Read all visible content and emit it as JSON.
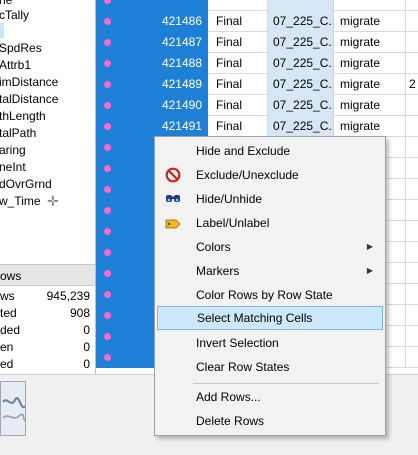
{
  "columns_panel": {
    "items": [
      {
        "label": "ne",
        "selected": false
      },
      {
        "label": "cTally",
        "selected": false
      },
      {
        "label": "",
        "selected": true
      },
      {
        "label": "SpdRes",
        "selected": false
      },
      {
        "label": "Attrb1",
        "selected": false
      },
      {
        "label": "imDistance",
        "selected": false
      },
      {
        "label": "talDistance",
        "selected": false
      },
      {
        "label": "thLength",
        "selected": false
      },
      {
        "label": "talPath",
        "selected": false
      },
      {
        "label": "aring",
        "selected": false
      },
      {
        "label": "neInt",
        "selected": false
      },
      {
        "label": "dOvrGrnd",
        "selected": false
      },
      {
        "label": "w_Time",
        "selected": false
      }
    ]
  },
  "rows_panel": {
    "header": "ows",
    "stats": [
      {
        "label": "ws",
        "value": "945,239"
      },
      {
        "label": "ted",
        "value": "908"
      },
      {
        "label": "ded",
        "value": "0"
      },
      {
        "label": "en",
        "value": "0"
      },
      {
        "label": "ed",
        "value": "0"
      }
    ]
  },
  "grid": {
    "rows": [
      {
        "id": "",
        "status": "",
        "code": "",
        "type": "",
        "last": ""
      },
      {
        "id": "421486",
        "status": "Final",
        "code": "07_225_C...",
        "type": "migrate",
        "last": ""
      },
      {
        "id": "421487",
        "status": "Final",
        "code": "07_225_C...",
        "type": "migrate",
        "last": ""
      },
      {
        "id": "421488",
        "status": "Final",
        "code": "07_225_C...",
        "type": "migrate",
        "last": ""
      },
      {
        "id": "421489",
        "status": "Final",
        "code": "07_225_C...",
        "type": "migrate",
        "last": "2"
      },
      {
        "id": "421490",
        "status": "Final",
        "code": "07_225_C...",
        "type": "migrate",
        "last": ""
      },
      {
        "id": "421491",
        "status": "Final",
        "code": "07_225_C...",
        "type": "migrate",
        "last": ""
      },
      {
        "id": "",
        "status": "",
        "code": "",
        "type": "",
        "last": ""
      },
      {
        "id": "",
        "status": "",
        "code": "",
        "type": "",
        "last": ""
      },
      {
        "id": "",
        "status": "",
        "code": "",
        "type": "",
        "last": ""
      },
      {
        "id": "",
        "status": "",
        "code": "",
        "type": "",
        "last": ""
      },
      {
        "id": "",
        "status": "",
        "code": "",
        "type": "",
        "last": ""
      },
      {
        "id": "",
        "status": "",
        "code": "",
        "type": "",
        "last": ""
      },
      {
        "id": "",
        "status": "",
        "code": "",
        "type": "",
        "last": ""
      },
      {
        "id": "",
        "status": "",
        "code": "",
        "type": "",
        "last": ""
      },
      {
        "id": "",
        "status": "",
        "code": "",
        "type": "",
        "last": ""
      },
      {
        "id": "",
        "status": "",
        "code": "",
        "type": "",
        "last": ""
      },
      {
        "id": "",
        "status": "",
        "code": "",
        "type": "",
        "last": ""
      }
    ]
  },
  "context_menu": {
    "items": [
      {
        "label": "Hide and Exclude",
        "icon": "",
        "submenu": false,
        "highlighted": false
      },
      {
        "label": "Exclude/Unexclude",
        "icon": "exclude-icon",
        "submenu": false,
        "highlighted": false
      },
      {
        "label": "Hide/Unhide",
        "icon": "hide-icon",
        "submenu": false,
        "highlighted": false
      },
      {
        "label": "Label/Unlabel",
        "icon": "label-icon",
        "submenu": false,
        "highlighted": false
      },
      {
        "label": "Colors",
        "icon": "",
        "submenu": true,
        "highlighted": false
      },
      {
        "label": "Markers",
        "icon": "",
        "submenu": true,
        "highlighted": false
      },
      {
        "label": "Color Rows by Row State",
        "icon": "",
        "submenu": false,
        "highlighted": false
      },
      {
        "label": "Select Matching Cells",
        "icon": "",
        "submenu": false,
        "highlighted": true
      },
      {
        "label": "Invert Selection",
        "icon": "",
        "submenu": false,
        "highlighted": false
      },
      {
        "label": "Clear Row States",
        "icon": "",
        "submenu": false,
        "highlighted": false
      },
      {
        "label": "Add Rows...",
        "icon": "",
        "submenu": false,
        "highlighted": false
      },
      {
        "label": "Delete Rows",
        "icon": "",
        "submenu": false,
        "highlighted": false
      }
    ]
  },
  "colors": {
    "selection_blue": "#1e7fd6",
    "marker_pink": "#ff66cc",
    "menu_highlight": "#cde8fb"
  }
}
